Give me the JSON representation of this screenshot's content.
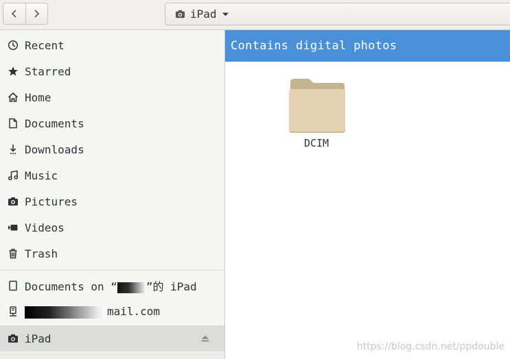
{
  "header": {
    "back_icon": "chevron-left-icon",
    "forward_icon": "chevron-right-icon",
    "path": {
      "label": "iPad",
      "icon": "camera-icon",
      "dropdown_icon": "caret-down-icon"
    }
  },
  "sidebar": {
    "items": [
      {
        "label": "Recent",
        "icon": "clock-icon"
      },
      {
        "label": "Starred",
        "icon": "star-icon"
      },
      {
        "label": "Home",
        "icon": "home-icon"
      },
      {
        "label": "Documents",
        "icon": "document-icon"
      },
      {
        "label": "Downloads",
        "icon": "download-icon"
      },
      {
        "label": "Music",
        "icon": "music-icon"
      },
      {
        "label": "Pictures",
        "icon": "camera-icon"
      },
      {
        "label": "Videos",
        "icon": "video-icon"
      },
      {
        "label": "Trash",
        "icon": "trash-icon"
      }
    ],
    "devices": [
      {
        "label_prefix": "Documents on “",
        "label_suffix": "”的 iPad",
        "icon": "tablet-icon"
      },
      {
        "label_suffix": "mail.com",
        "icon": "network-drive-icon"
      },
      {
        "label": "iPad",
        "icon": "camera-icon",
        "eject_icon": "eject-icon",
        "active": true
      }
    ]
  },
  "content": {
    "banner": "Contains digital photos",
    "files": [
      {
        "name": "DCIM",
        "icon": "folder-icon"
      }
    ]
  },
  "watermark": "https://blog.csdn.net/ppdouble",
  "colors": {
    "accent": "#4a90d9",
    "sidebar_bg": "#f5f5f4",
    "folder": "#e3d0b2"
  }
}
